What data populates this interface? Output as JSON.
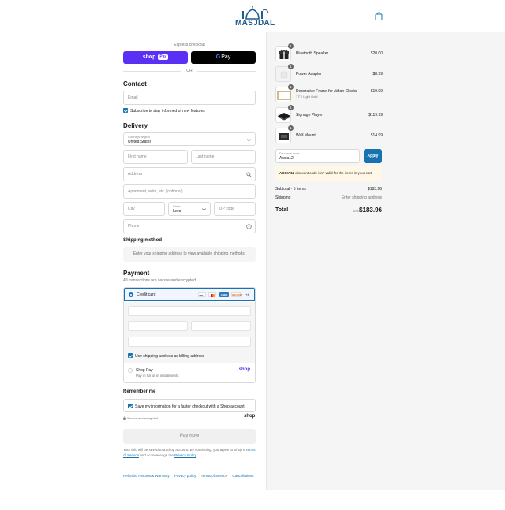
{
  "header": {
    "logo_text": "MASJDAL"
  },
  "express": {
    "label": "Express checkout",
    "shop_pay": "shop",
    "shop_pay_badge": "Pay",
    "google_pay": "Pay",
    "google_g": "G",
    "or": "OR"
  },
  "contact": {
    "title": "Contact",
    "email_placeholder": "Email",
    "subscribe_label": "Subscribe to stay informed of new features"
  },
  "delivery": {
    "title": "Delivery",
    "country_label": "Country/Region",
    "country_value": "United States",
    "first_name": "First name",
    "last_name": "Last name",
    "address": "Address",
    "apartment": "Apartment, suite, etc. (optional)",
    "city": "City",
    "state_label": "State",
    "state_value": "Iowa",
    "zip": "ZIP code",
    "phone": "Phone"
  },
  "shipping": {
    "title": "Shipping method",
    "message": "Enter your shipping address to view available shipping methods."
  },
  "payment": {
    "title": "Payment",
    "subtitle": "All transactions are secure and encrypted.",
    "credit_card": "Credit card",
    "brands": [
      "VISA",
      "MC",
      "AMEX",
      "DISCOVER"
    ],
    "more_brands": "+4",
    "billing_label": "Use shipping address as billing address",
    "shop_pay": "Shop Pay",
    "shop_pay_sub": "Pay in full or in installments",
    "shop_pay_logo": "shop"
  },
  "remember": {
    "title": "Remember me",
    "save_label": "Save my information for a faster checkout with a Shop account",
    "secure": "Secure and encrypted",
    "shop_logo": "shop"
  },
  "pay_now": "Pay now",
  "legal": {
    "text": "Your info will be saved to a Shop account. By continuing, you agree to Shop's",
    "tos": "Terms of Service",
    "and": "and acknowledge the",
    "privacy": "Privacy Policy",
    "end": "."
  },
  "footer": [
    "Refunds, Returns & Warranty",
    "Privacy policy",
    "Terms of Service",
    "Cancellations"
  ],
  "cart": {
    "items": [
      {
        "name": "Bluetooth Speaker",
        "sub": "",
        "price": "$20.00",
        "qty": "1"
      },
      {
        "name": "Power Adapter",
        "sub": "",
        "price": "$8.99",
        "qty": "1"
      },
      {
        "name": "Decorative Frame for Athan Clocks",
        "sub": "17\" / Light Gold",
        "price": "$19.99",
        "qty": "1"
      },
      {
        "name": "Signage Player",
        "sub": "",
        "price": "$119.99",
        "qty": "1"
      },
      {
        "name": "Wall Mount",
        "sub": "",
        "price": "$14.99",
        "qty": "1"
      }
    ],
    "discount_label": "Discount code",
    "discount_value": "Ascia12",
    "apply": "Apply",
    "error_code": "ASCIA12",
    "error_text": " discount code isn't valid for the items in your cart",
    "subtotal_label": "Subtotal · 5 items",
    "subtotal_value": "$183.96",
    "shipping_label": "Shipping",
    "shipping_value": "Enter shipping address",
    "total_label": "Total",
    "currency": "USD",
    "total_value": "$183.96"
  },
  "colors": {
    "accent": "#1773b0",
    "shop_purple": "#5a31f4",
    "logo": "#1f5c8f"
  }
}
